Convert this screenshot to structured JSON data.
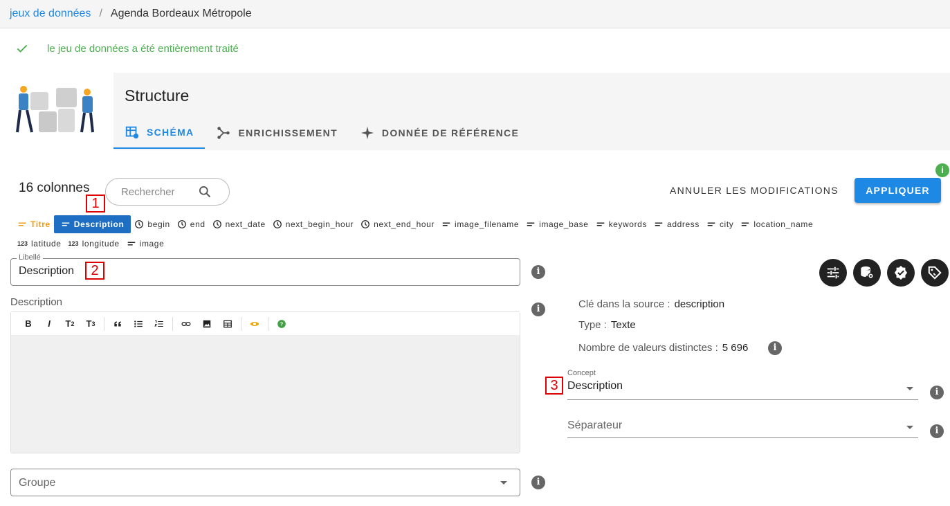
{
  "breadcrumb": {
    "root": "jeux de données",
    "separator": "/",
    "current": "Agenda Bordeaux Métropole"
  },
  "alert": {
    "text": "le jeu de données a été entièrement traité",
    "color": "#4caf50"
  },
  "structure": {
    "title": "Structure",
    "tabs": [
      {
        "label": "SCHÉMA",
        "icon": "table-edit-icon",
        "active": true
      },
      {
        "label": "ENRICHISSEMENT",
        "icon": "merge-icon",
        "active": false
      },
      {
        "label": "DONNÉE DE RÉFÉRENCE",
        "icon": "star-four-points-icon",
        "active": false
      }
    ]
  },
  "columns": {
    "count_label": "16 colonnes",
    "search_placeholder": "Rechercher",
    "cancel_label": "ANNULER LES MODIFICATIONS",
    "apply_label": "APPLIQUER",
    "badge": "i",
    "row1": [
      {
        "label": "Titre",
        "icon": "text-short-icon",
        "state": "title"
      },
      {
        "label": "Description",
        "icon": "text-short-icon",
        "state": "selected"
      },
      {
        "label": "begin",
        "icon": "clock-icon"
      },
      {
        "label": "end",
        "icon": "clock-icon"
      },
      {
        "label": "next_date",
        "icon": "clock-icon"
      },
      {
        "label": "next_begin_hour",
        "icon": "clock-icon"
      },
      {
        "label": "next_end_hour",
        "icon": "clock-icon"
      },
      {
        "label": "image_filename",
        "icon": "text-short-icon"
      },
      {
        "label": "image_base",
        "icon": "text-short-icon"
      },
      {
        "label": "keywords",
        "icon": "text-short-icon"
      },
      {
        "label": "address",
        "icon": "text-short-icon"
      },
      {
        "label": "city",
        "icon": "text-short-icon"
      },
      {
        "label": "location_name",
        "icon": "text-short-icon"
      }
    ],
    "row2": [
      {
        "label": "latitude",
        "icon": "numeric-icon"
      },
      {
        "label": "longitude",
        "icon": "numeric-icon"
      },
      {
        "label": "image",
        "icon": "text-short-icon"
      }
    ]
  },
  "markers": [
    "1",
    "2",
    "3"
  ],
  "form": {
    "libelle_legend": "Libellé",
    "libelle_value": "Description",
    "description_label": "Description",
    "toolbar": [
      "B",
      "I",
      "T",
      "T"
    ],
    "toolbar_subs": [
      "2",
      "3"
    ],
    "groupe_placeholder": "Groupe",
    "info": "i"
  },
  "details": {
    "source_key_label": "Clé dans la source :",
    "source_key_value": "description",
    "type_label": "Type :",
    "type_value": "Texte",
    "distinct_label": "Nombre de valeurs distinctes :",
    "distinct_value": "5 696",
    "concept_label": "Concept",
    "concept_value": "Description",
    "separator_placeholder": "Séparateur"
  }
}
